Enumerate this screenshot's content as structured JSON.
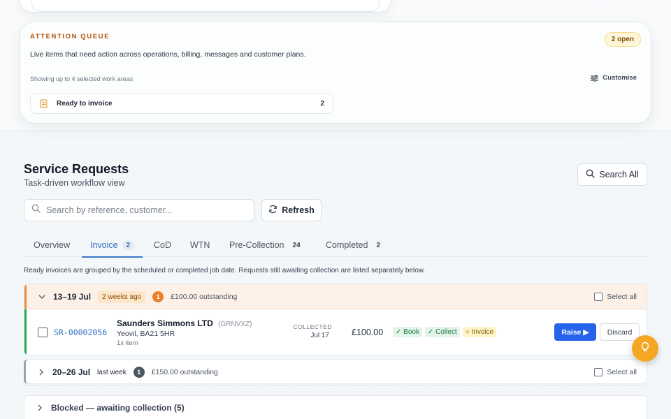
{
  "attention": {
    "title": "ATTENTION QUEUE",
    "open_badge": "2 open",
    "description": "Live items that need action across operations, billing, messages and customer plans.",
    "showing": "Showing up to 4 selected work areas",
    "customise_label": "Customise",
    "items": [
      {
        "label": "Ready to invoice",
        "count": "2",
        "icon": "document-icon"
      }
    ]
  },
  "service_requests": {
    "title": "Service Requests",
    "subtitle": "Task-driven workflow view",
    "search_all_label": "Search All",
    "search_placeholder": "Search by reference, customer...",
    "refresh_label": "Refresh",
    "tabs": [
      {
        "label": "Overview",
        "badge": ""
      },
      {
        "label": "Invoice",
        "badge": "2",
        "active": true
      },
      {
        "label": "CoD",
        "badge": ""
      },
      {
        "label": "WTN",
        "badge": ""
      },
      {
        "label": "Pre-Collection",
        "badge": "24"
      },
      {
        "label": "Completed",
        "badge": "2"
      }
    ],
    "info": "Ready invoices are grouped by the scheduled or completed job date. Requests still awaiting collection are listed separately below.",
    "groups": [
      {
        "range": "13–19 Jul",
        "age": "2 weeks ago",
        "count": "1",
        "outstanding": "£100.00 outstanding",
        "select_all": "Select all",
        "accent_color": "#f28a3d",
        "rows": [
          {
            "ref": "SR-00002056",
            "customer": "Saunders Simmons LTD",
            "code": "(GRNVXZ)",
            "address": "Yeovil, BA21 5HR",
            "items": "1x item",
            "status_label": "COLLECTED",
            "status_date": "Jul 17",
            "amount": "£100.00",
            "chips": [
              "✓ Book",
              "✓ Collect",
              "○ Invoice"
            ],
            "raise_label": "Raise ▶",
            "discard_label": "Discard"
          }
        ]
      },
      {
        "range": "20–26 Jul",
        "age": "last week",
        "count": "1",
        "outstanding": "£150.00 outstanding",
        "select_all": "Select all",
        "accent_color": "#9aa3ad"
      }
    ],
    "blocked_label": "Blocked — awaiting collection (5)"
  },
  "colors": {
    "accent_blue": "#2563eb",
    "attention_orange": "#b45309",
    "fab": "#f5a623"
  }
}
